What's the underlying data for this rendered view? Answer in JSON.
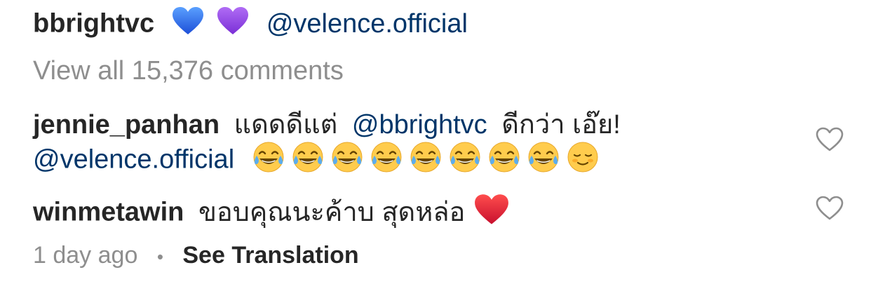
{
  "caption": {
    "username": "bbrightvc",
    "emojis": [
      "blue-heart",
      "purple-heart"
    ],
    "mention": "@velence.official"
  },
  "view_all_comments": "View all 15,376 comments",
  "comments": [
    {
      "username": "jennie_panhan",
      "text_before_mention": "แดดดีแต่",
      "mention": "@bbrightvc",
      "text_after_mention": "ดีกว่า เอ๊ย!",
      "second_line_mention": "@velence.official",
      "emojis": [
        "tears-of-joy",
        "tears-of-joy",
        "tears-of-joy",
        "tears-of-joy",
        "tears-of-joy",
        "tears-of-joy",
        "tears-of-joy",
        "tears-of-joy",
        "smiling-face"
      ]
    },
    {
      "username": "winmetawin",
      "text": "ขอบคุณนะค้าบ สุดหล่อ",
      "emojis": [
        "red-heart"
      ]
    }
  ],
  "meta": {
    "time": "1 day ago",
    "separator": "•",
    "see_translation": "See Translation"
  },
  "colors": {
    "text": "#262626",
    "muted": "#8e8e8e",
    "mention": "#003569"
  }
}
